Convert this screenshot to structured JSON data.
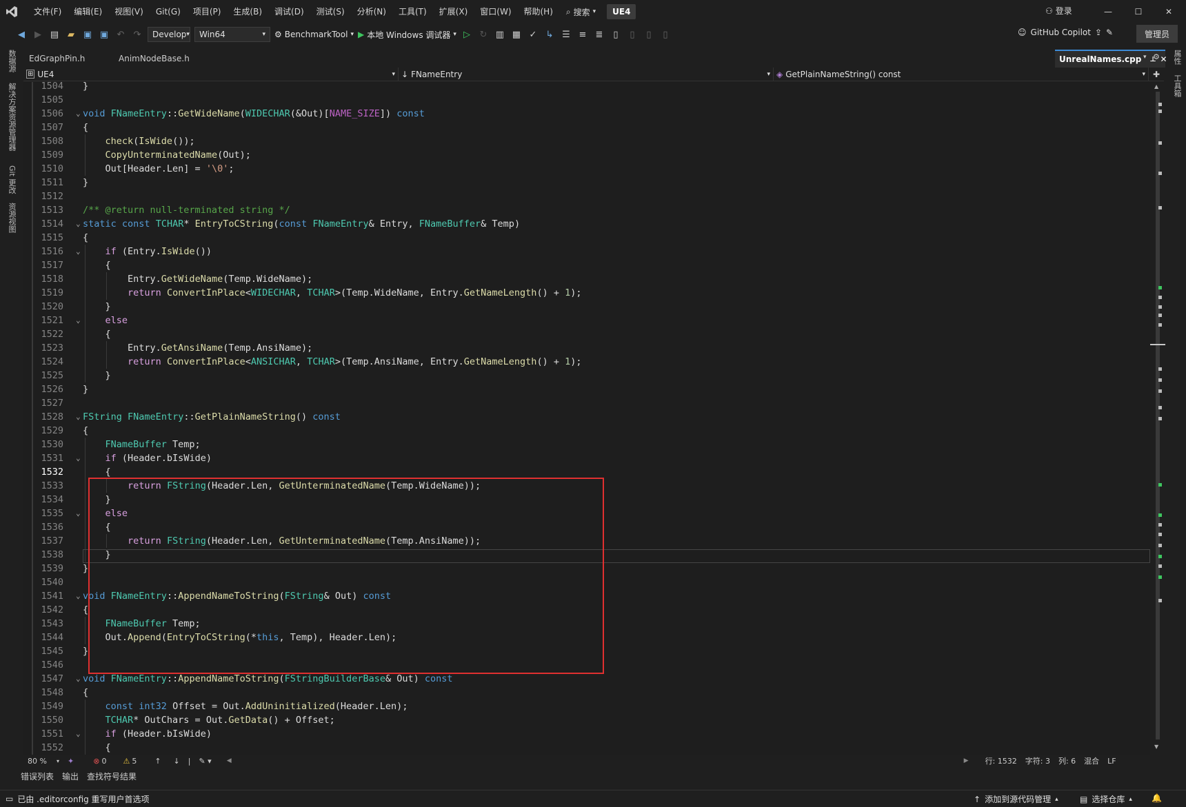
{
  "menu": {
    "items": [
      "文件(F)",
      "编辑(E)",
      "视图(V)",
      "Git(G)",
      "项目(P)",
      "生成(B)",
      "调试(D)",
      "测试(S)",
      "分析(N)",
      "工具(T)",
      "扩展(X)",
      "窗口(W)",
      "帮助(H)"
    ],
    "search_label": "搜索",
    "solution_name": "UE4",
    "login_label": "登录"
  },
  "toolbar": {
    "configuration": "Develop",
    "platform": "Win64",
    "startup_project": "BenchmarkTool",
    "debugger": "本地 Windows 调试器",
    "copilot_label": "GitHub Copilot",
    "admin_label": "管理员"
  },
  "left_strip": {
    "tabs": [
      "数据源",
      "解决方案资源管理器",
      "Git 更改",
      "资源视图"
    ]
  },
  "right_strip": {
    "tabs": [
      "属性",
      "工具箱"
    ]
  },
  "doc_tabs": {
    "tabs": [
      "EdGraphPin.h",
      "AnimNodeBase.h"
    ],
    "active": "UnrealNames.cpp"
  },
  "nav_bar": {
    "project": "UE4",
    "scope": "FNameEntry",
    "member": "GetPlainNameString() const"
  },
  "editor": {
    "current_line": 1532,
    "lines": [
      {
        "n": "1504",
        "t": "}"
      },
      {
        "n": "1505",
        "t": ""
      },
      {
        "n": "1506",
        "t": "void FNameEntry::GetWideName(WIDECHAR(&Out)[NAME_SIZE]) const"
      },
      {
        "n": "1507",
        "t": "{"
      },
      {
        "n": "1508",
        "t": "    check(IsWide());"
      },
      {
        "n": "1509",
        "t": "    CopyUnterminatedName(Out);"
      },
      {
        "n": "1510",
        "t": "    Out[Header.Len] = '\\0';"
      },
      {
        "n": "1511",
        "t": "}"
      },
      {
        "n": "1512",
        "t": ""
      },
      {
        "n": "1513",
        "t": "/** @return null-terminated string */"
      },
      {
        "n": "1514",
        "t": "static const TCHAR* EntryToCString(const FNameEntry& Entry, FNameBuffer& Temp)"
      },
      {
        "n": "1515",
        "t": "{"
      },
      {
        "n": "1516",
        "t": "    if (Entry.IsWide())"
      },
      {
        "n": "1517",
        "t": "    {"
      },
      {
        "n": "1518",
        "t": "        Entry.GetWideName(Temp.WideName);"
      },
      {
        "n": "1519",
        "t": "        return ConvertInPlace<WIDECHAR, TCHAR>(Temp.WideName, Entry.GetNameLength() + 1);"
      },
      {
        "n": "1520",
        "t": "    }"
      },
      {
        "n": "1521",
        "t": "    else"
      },
      {
        "n": "1522",
        "t": "    {"
      },
      {
        "n": "1523",
        "t": "        Entry.GetAnsiName(Temp.AnsiName);"
      },
      {
        "n": "1524",
        "t": "        return ConvertInPlace<ANSICHAR, TCHAR>(Temp.AnsiName, Entry.GetNameLength() + 1);"
      },
      {
        "n": "1525",
        "t": "    }"
      },
      {
        "n": "1526",
        "t": "}"
      },
      {
        "n": "1527",
        "t": ""
      },
      {
        "n": "1528",
        "t": "FString FNameEntry::GetPlainNameString() const"
      },
      {
        "n": "1529",
        "t": "{"
      },
      {
        "n": "1530",
        "t": "    FNameBuffer Temp;"
      },
      {
        "n": "1531",
        "t": "    if (Header.bIsWide)"
      },
      {
        "n": "1532",
        "t": "    {"
      },
      {
        "n": "1533",
        "t": "        return FString(Header.Len, GetUnterminatedName(Temp.WideName));"
      },
      {
        "n": "1534",
        "t": "    }"
      },
      {
        "n": "1535",
        "t": "    else"
      },
      {
        "n": "1536",
        "t": "    {"
      },
      {
        "n": "1537",
        "t": "        return FString(Header.Len, GetUnterminatedName(Temp.AnsiName));"
      },
      {
        "n": "1538",
        "t": "    }"
      },
      {
        "n": "1539",
        "t": "}"
      },
      {
        "n": "1540",
        "t": ""
      },
      {
        "n": "1541",
        "t": "void FNameEntry::AppendNameToString(FString& Out) const"
      },
      {
        "n": "1542",
        "t": "{"
      },
      {
        "n": "1543",
        "t": "    FNameBuffer Temp;"
      },
      {
        "n": "1544",
        "t": "    Out.Append(EntryToCString(*this, Temp), Header.Len);"
      },
      {
        "n": "1545",
        "t": "}"
      },
      {
        "n": "1546",
        "t": ""
      },
      {
        "n": "1547",
        "t": "void FNameEntry::AppendNameToString(FStringBuilderBase& Out) const"
      },
      {
        "n": "1548",
        "t": "{"
      },
      {
        "n": "1549",
        "t": "    const int32 Offset = Out.AddUninitialized(Header.Len);"
      },
      {
        "n": "1550",
        "t": "    TCHAR* OutChars = Out.GetData() + Offset;"
      },
      {
        "n": "1551",
        "t": "    if (Header.bIsWide)"
      },
      {
        "n": "1552",
        "t": "    {"
      }
    ]
  },
  "editor_status": {
    "zoom": "80 %",
    "errors": "0",
    "warnings": "5",
    "line": "行: 1532",
    "char": "字符: 3",
    "col": "列: 6",
    "indent": "混合",
    "eol": "LF"
  },
  "bottom_tabs": [
    "错误列表",
    "输出",
    "查找符号结果"
  ],
  "statusbar": {
    "message": "已由 .editorconfig 重写用户首选项",
    "source_control": "添加到源代码管理",
    "repo": "选择仓库"
  },
  "colors": {
    "highlight_rect": "#e03030",
    "keyword": "#569cd6",
    "type": "#4ec9b0",
    "function": "#dcdcaa",
    "comment": "#57a64a"
  }
}
